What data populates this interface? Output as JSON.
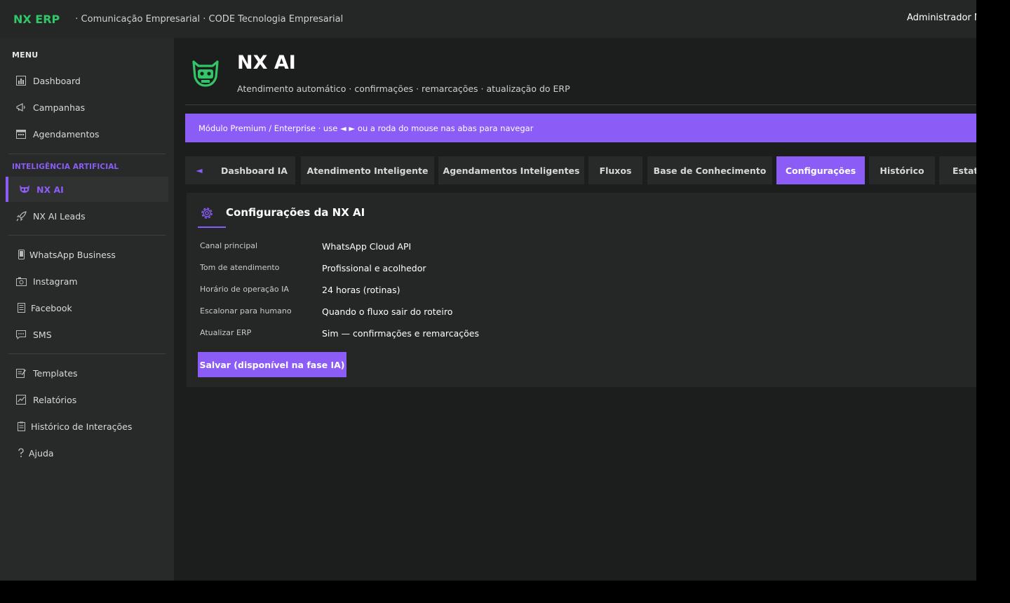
{
  "topbar": {
    "brand": "NX ERP",
    "org": "· Comunicação Empresarial · CODE Tecnologia Empresarial",
    "user": "Administrador M"
  },
  "sidebar": {
    "menu_title": "MENU",
    "items_top": [
      {
        "label": "Dashboard",
        "icon": "bar-chart-icon"
      },
      {
        "label": "Campanhas",
        "icon": "megaphone-icon"
      },
      {
        "label": "Agendamentos",
        "icon": "calendar-icon"
      }
    ],
    "ai_section_title": "INTELIGÊNCIA ARTIFICIAL",
    "items_ai": [
      {
        "label": "NX AI",
        "icon": "robot-icon",
        "active": true
      },
      {
        "label": "NX AI Leads",
        "icon": "rocket-icon"
      }
    ],
    "items_channels": [
      {
        "label": "WhatsApp Business",
        "icon": "phone-icon"
      },
      {
        "label": "Instagram",
        "icon": "camera-icon"
      },
      {
        "label": "Facebook",
        "icon": "book-icon"
      },
      {
        "label": "SMS",
        "icon": "chat-icon"
      }
    ],
    "items_bottom": [
      {
        "label": "Templates",
        "icon": "memo-icon"
      },
      {
        "label": "Relatórios",
        "icon": "chart-check-icon"
      },
      {
        "label": "Histórico de Interações",
        "icon": "clipboard-icon"
      },
      {
        "label": "Ajuda",
        "icon": "question-icon"
      }
    ]
  },
  "page": {
    "title": "NX AI",
    "subtitle": "Atendimento automático · confirmações · remarcações · atualização do ERP"
  },
  "banner": {
    "text": "Módulo Premium / Enterprise · use ◄ ► ou a roda do mouse nas abas para navegar"
  },
  "tabs": {
    "prev_label": "◄",
    "items": [
      {
        "label": "Dashboard IA"
      },
      {
        "label": "Atendimento Inteligente"
      },
      {
        "label": "Agendamentos Inteligentes"
      },
      {
        "label": "Fluxos"
      },
      {
        "label": "Base de Conhecimento"
      },
      {
        "label": "Configurações",
        "active": true
      },
      {
        "label": "Histórico"
      },
      {
        "label": "Estat"
      }
    ]
  },
  "settings": {
    "title": "Configurações da NX AI",
    "rows": [
      {
        "label": "Canal principal",
        "value": "WhatsApp Cloud API"
      },
      {
        "label": "Tom de atendimento",
        "value": "Profissional e acolhedor"
      },
      {
        "label": "Horário de operação IA",
        "value": "24 horas (rotinas)"
      },
      {
        "label": "Escalonar para humano",
        "value": "Quando o fluxo sair do roteiro"
      },
      {
        "label": "Atualizar ERP",
        "value": "Sim — confirmações e remarcações"
      }
    ],
    "save_label": "Salvar (disponível na fase IA)"
  },
  "colors": {
    "accent": "#8b5cf6",
    "brand": "#31c768",
    "background": "#1c1e1d",
    "panel": "#242726"
  }
}
